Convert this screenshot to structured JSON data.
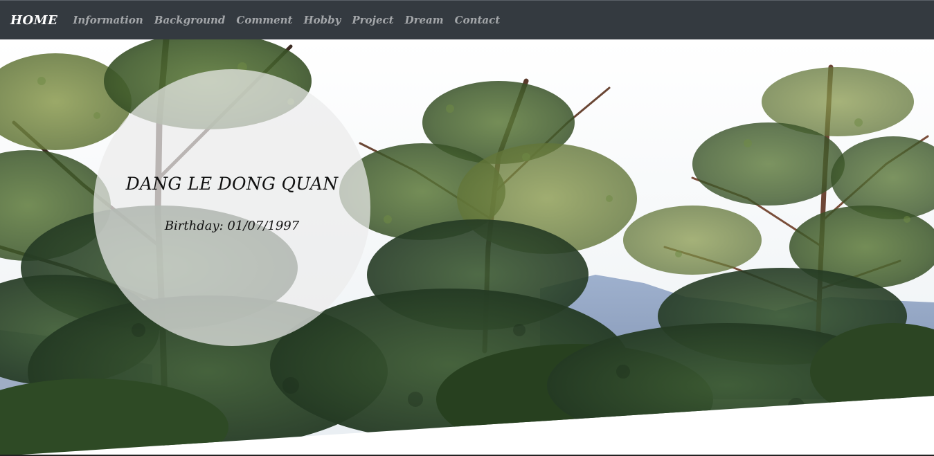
{
  "navbar": {
    "brand": "HOME",
    "links": [
      "Information",
      "Background",
      "Comment",
      "Hobby",
      "Project",
      "Dream",
      "Contact"
    ]
  },
  "profile": {
    "name": "DANG LE DONG QUAN",
    "birthday": "Birthday: 01/07/1997"
  },
  "colors": {
    "navbar_bg": "#343a40",
    "nav_link": "rgba(255,255,255,0.55)",
    "brand": "#ffffff"
  }
}
